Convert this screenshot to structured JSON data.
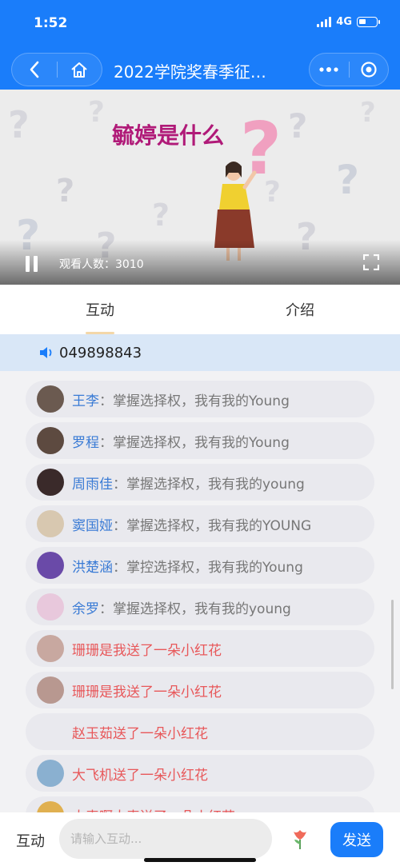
{
  "status": {
    "time": "1:52",
    "network": "4G"
  },
  "nav": {
    "title": "2022学院奖春季征…"
  },
  "video": {
    "caption": "毓婷是什么",
    "viewers": "观看人数：3010"
  },
  "tabs": [
    {
      "label": "互动",
      "active": true
    },
    {
      "label": "介绍",
      "active": false
    }
  ],
  "notice": {
    "text": "049898843"
  },
  "messages": [
    {
      "name": "王李",
      "sep": "：",
      "text": "掌握选择权，我有我的Young",
      "avatar_color": "#6b5a50",
      "type": "comment"
    },
    {
      "name": "罗程",
      "sep": "：",
      "text": "掌握选择权，我有我的Young",
      "avatar_color": "#5d4a40",
      "type": "comment"
    },
    {
      "name": "周雨佳",
      "sep": "：",
      "text": "掌握选择权，我有我的young",
      "avatar_color": "#3a2a2a",
      "type": "comment"
    },
    {
      "name": "窦国娅",
      "sep": "：",
      "text": "掌握选择权，我有我的YOUNG",
      "avatar_color": "#d8c8b0",
      "type": "comment"
    },
    {
      "name": "洪楚涵",
      "sep": "：",
      "text": "掌控选择权，我有我的Young",
      "avatar_color": "#6a4aa8",
      "type": "comment"
    },
    {
      "name": "余罗",
      "sep": "：",
      "text": "掌握选择权，我有我的young",
      "avatar_color": "#e8c8dc",
      "type": "comment"
    },
    {
      "text": "珊珊是我送了一朵小红花",
      "avatar_color": "#c8a8a0",
      "type": "gift"
    },
    {
      "text": "珊珊是我送了一朵小红花",
      "avatar_color": "#b89890",
      "type": "gift"
    },
    {
      "text": "赵玉茹送了一朵小红花",
      "avatar_color": "",
      "type": "gift"
    },
    {
      "text": "大飞机送了一朵小红花",
      "avatar_color": "#8ab0d0",
      "type": "gift"
    },
    {
      "text": "大表啊大表送了一朵小红花",
      "avatar_color": "#e0b050",
      "type": "gift"
    }
  ],
  "bottom": {
    "label": "互动",
    "placeholder": "请输入互动...",
    "send": "发送"
  },
  "colors": {
    "accent": "#1a7dfa",
    "name": "#3a7bd5",
    "gift": "#e8585a"
  }
}
